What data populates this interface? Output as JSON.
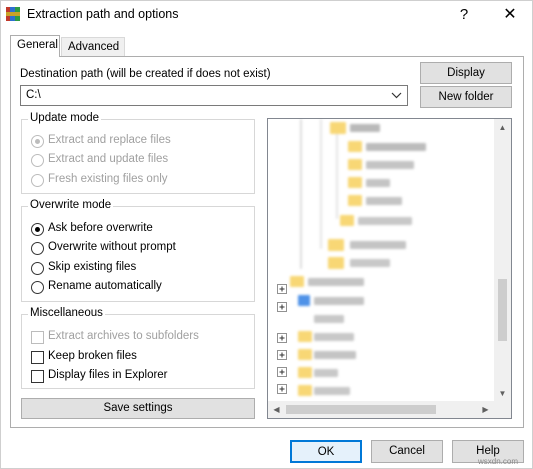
{
  "window": {
    "title": "Extraction path and options",
    "help_glyph": "?",
    "close_glyph": "✕"
  },
  "tabs": [
    {
      "label": "General",
      "active": true
    },
    {
      "label": "Advanced",
      "active": false
    }
  ],
  "destination": {
    "label": "Destination path (will be created if does not exist)",
    "value": "C:\\"
  },
  "buttons": {
    "display": "Display",
    "new_folder": "New folder",
    "save_settings": "Save settings",
    "ok": "OK",
    "cancel": "Cancel",
    "help": "Help"
  },
  "update_mode": {
    "title": "Update mode",
    "options": [
      {
        "label": "Extract and replace files",
        "selected": true,
        "enabled": false
      },
      {
        "label": "Extract and update files",
        "selected": false,
        "enabled": false
      },
      {
        "label": "Fresh existing files only",
        "selected": false,
        "enabled": false
      }
    ]
  },
  "overwrite_mode": {
    "title": "Overwrite mode",
    "options": [
      {
        "label": "Ask before overwrite",
        "selected": true
      },
      {
        "label": "Overwrite without prompt",
        "selected": false
      },
      {
        "label": "Skip existing files",
        "selected": false
      },
      {
        "label": "Rename automatically",
        "selected": false
      }
    ]
  },
  "miscellaneous": {
    "title": "Miscellaneous",
    "options": [
      {
        "label": "Extract archives to subfolders",
        "checked": false,
        "enabled": false
      },
      {
        "label": "Keep broken files",
        "checked": false,
        "enabled": true
      },
      {
        "label": "Display files in Explorer",
        "checked": false,
        "enabled": true
      }
    ]
  },
  "colors": {
    "accent": "#0078d7",
    "folder": "#f8d775",
    "button_face": "#e1e1e1"
  },
  "watermark": "wsxdn.com"
}
